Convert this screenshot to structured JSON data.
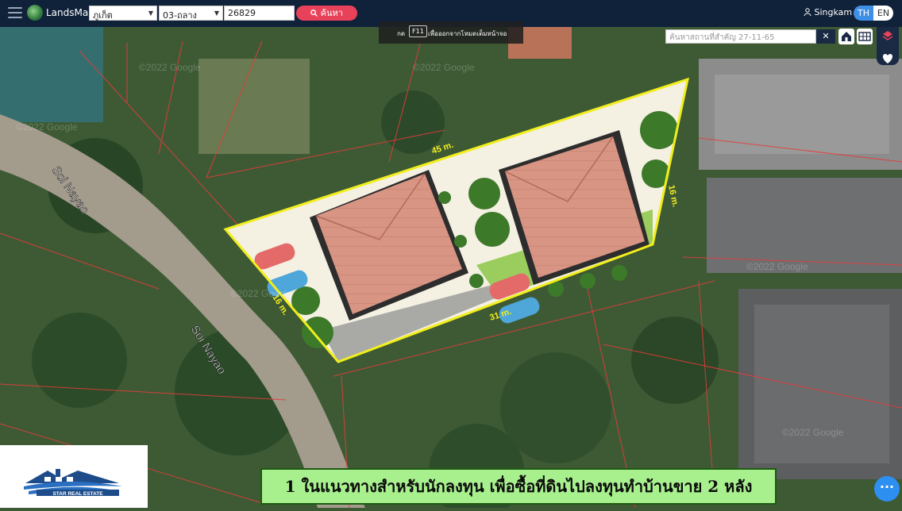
{
  "app": {
    "name": "LandsMaps",
    "icon": "globe-logo-icon",
    "menu_icon": "hamburger-menu-icon"
  },
  "search_bar": {
    "province": "ภูเก็ต",
    "district": "03-ถลาง",
    "parcel_number": "26829",
    "search_label": "ค้นหา",
    "search_icon": "search-icon"
  },
  "user": {
    "name": "Singkam",
    "icon": "user-icon"
  },
  "language": {
    "th": "TH",
    "en": "EN",
    "active": "TH"
  },
  "fullscreen_hint": {
    "prefix": "กด",
    "key": "F11",
    "message": "เพื่อออกจากโหมดเต็มหน้าจอ"
  },
  "place_search": {
    "placeholder": "ค้นหาสถานที่สำคัญ   27-11-65"
  },
  "tools": {
    "clear_icon": "close-icon",
    "home_icon": "home-icon",
    "grid_icon": "grid-icon",
    "layers_icon": "layers-icon",
    "favorite_icon": "heart-icon"
  },
  "map": {
    "road_labels": [
      "Soi Nayao",
      "Soi Nayao"
    ],
    "dimensions": [
      "45 m.",
      "16 m.",
      "16 m.",
      "31 m."
    ],
    "watermarks": [
      "©2022 Google",
      "©2022 Google",
      "©2022 Google",
      "©2022 Google",
      "©2022 Google",
      "©2022 Google"
    ]
  },
  "company": {
    "name": "STAR REAL ESTATE"
  },
  "banner": {
    "text": "1 ในแนวทางสำหรับนักลงทุน เพื่อซื้อที่ดินไปลงทุนทำบ้านขาย 2 หลัง"
  },
  "chat": {
    "icon": "chat-dots-icon"
  },
  "colors": {
    "topbar": "#10213a",
    "search_button": "#e8425a",
    "plot_border": "#f2ee1c",
    "parcel_lines": "#e43c3c",
    "banner_bg": "#a8f08e",
    "lang_active": "#3f8fe6"
  }
}
